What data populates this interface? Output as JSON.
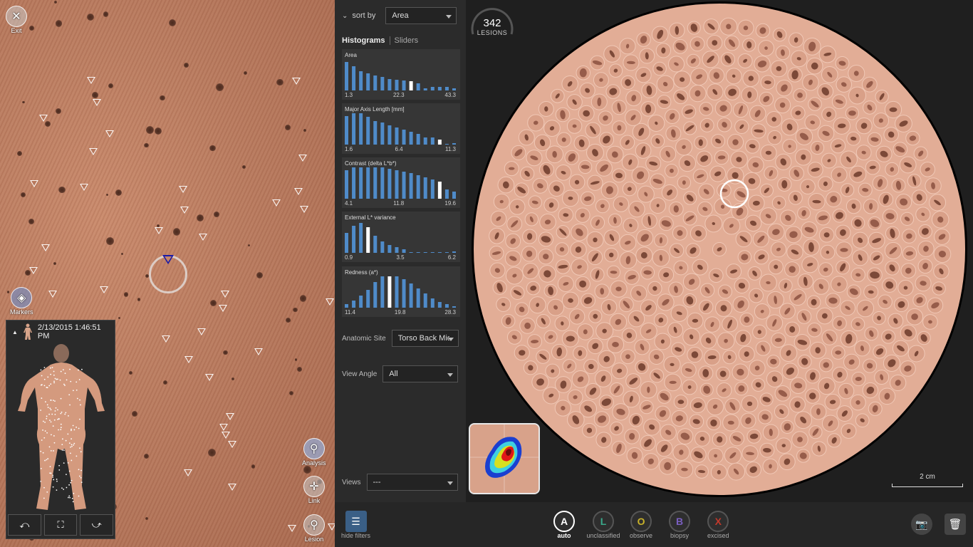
{
  "viewer": {
    "exit_label": "Exit",
    "markers_label": "Markers",
    "analysis_label": "Analysis",
    "link_label": "Link",
    "lesion_label": "Lesion",
    "timestamp": "2/13/2015 1:46:51 PM"
  },
  "filters": {
    "sort_label": "sort by",
    "sort_value": "Area",
    "tab_histograms": "Histograms",
    "tab_sliders": "Sliders",
    "histograms": [
      {
        "title": "Area",
        "ticks": [
          "1.3",
          "22.3",
          "43.3"
        ],
        "bars": [
          40,
          34,
          27,
          24,
          21,
          19,
          16,
          15,
          14,
          13,
          10,
          3,
          5,
          5,
          5,
          3
        ],
        "selected": 9
      },
      {
        "title": "Major Axis Length [mm]",
        "ticks": [
          "1.6",
          "6.4",
          "11.3"
        ],
        "bars": [
          40,
          44,
          44,
          39,
          33,
          31,
          27,
          24,
          21,
          18,
          15,
          10,
          10,
          7,
          0,
          2
        ],
        "selected": 13
      },
      {
        "title": "Contrast (delta L*b*)",
        "ticks": [
          "4.1",
          "11.8",
          "19.6"
        ],
        "bars": [
          40,
          44,
          44,
          44,
          44,
          44,
          42,
          40,
          38,
          36,
          33,
          30,
          27,
          24,
          13,
          10
        ],
        "selected": 13
      },
      {
        "title": "External L* variance",
        "ticks": [
          "0.9",
          "3.5",
          "6.2"
        ],
        "bars": [
          28,
          38,
          42,
          36,
          24,
          16,
          11,
          8,
          5,
          0,
          0,
          0,
          0,
          0,
          0,
          2
        ],
        "selected": 3
      },
      {
        "title": "Redness (a*)",
        "ticks": [
          "11.4",
          "19.8",
          "28.3"
        ],
        "bars": [
          5,
          10,
          17,
          25,
          36,
          45,
          46,
          44,
          40,
          34,
          27,
          20,
          13,
          8,
          5,
          2
        ],
        "selected": 6
      }
    ],
    "anatomic_site_label": "Anatomic Site",
    "anatomic_site_value": "Torso Back Middle",
    "view_angle_label": "View Angle",
    "view_angle_value": "All",
    "views_label": "Views",
    "views_value": "---"
  },
  "main": {
    "lesion_count": "342",
    "lesion_count_label": "LESIONS",
    "scale_label": "2 cm"
  },
  "bottom": {
    "hide_filters_label": "hide filters",
    "classes": [
      {
        "letter": "A",
        "label": "auto",
        "color": "#ffffff",
        "active": true
      },
      {
        "letter": "L",
        "label": "unclassified",
        "color": "#3aa88a",
        "active": false
      },
      {
        "letter": "O",
        "label": "observe",
        "color": "#c8b22a",
        "active": false
      },
      {
        "letter": "B",
        "label": "biopsy",
        "color": "#7a5fc0",
        "active": false
      },
      {
        "letter": "X",
        "label": "excised",
        "color": "#c0392b",
        "active": false
      }
    ]
  },
  "colors": {
    "bar": "#4f8bc9",
    "bar_selected": "#ffffff",
    "panel": "#363636",
    "disk": "#e2ad96"
  }
}
